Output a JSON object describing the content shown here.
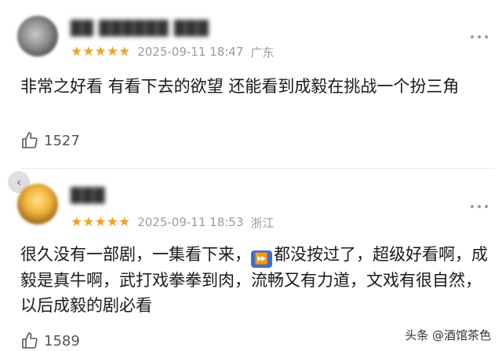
{
  "comments": [
    {
      "username": "██ ██████ ███",
      "stars": "★★★★★",
      "datetime": "2025-09-11 18:47",
      "location": "广东",
      "text": "非常之好看 有看下去的欲望 还能看到成毅在挑战一个扮三角",
      "likes": "1527"
    },
    {
      "username": "███",
      "stars": "★★★★★",
      "datetime": "2025-09-11 18:53",
      "location": "浙江",
      "text_before_icon": "很久没有一部剧，一集看下来，",
      "fast_forward_icon": "⏩",
      "text_after_icon": "都没按过了，超级好看啊，成毅是真牛啊，武打戏拳拳到肉，流畅又有力道，文戏有很自然，以后成毅的剧必看",
      "likes": "1589"
    }
  ],
  "collapse_icon": "‹",
  "watermark": "头条 @酒馆茶色",
  "colors": {
    "star": "#f7a21b",
    "meta": "#9b9b9b",
    "text": "#1a1a1a"
  }
}
